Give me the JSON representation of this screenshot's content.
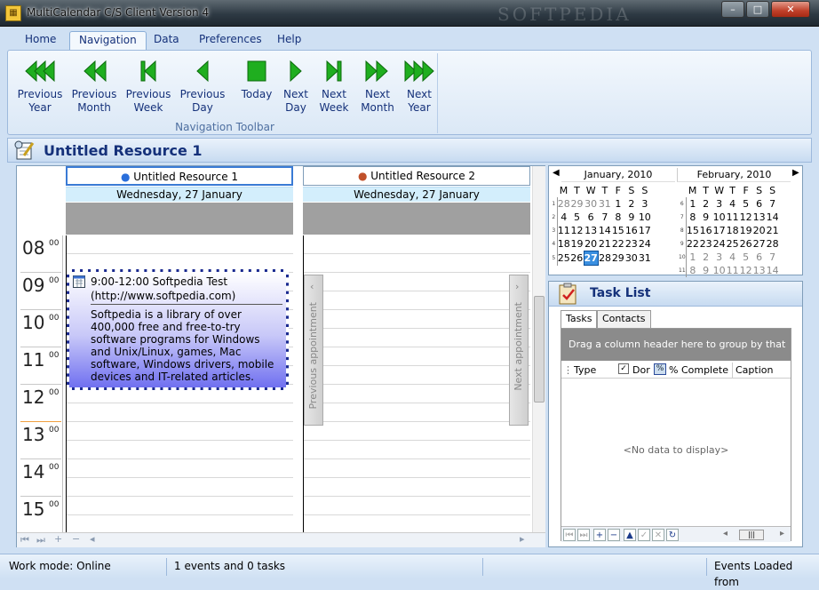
{
  "window": {
    "title": "MultiCalendar C/S Client Version 4",
    "watermark": "SOFTPEDIA",
    "controls": {
      "minimize": "–",
      "maximize": "□",
      "close": "✕"
    }
  },
  "ribbon": {
    "tabs": [
      "Home",
      "Navigation",
      "Data",
      "Preferences",
      "Help"
    ],
    "active_tab": "Navigation",
    "group_label": "Navigation Toolbar",
    "buttons": [
      {
        "line1": "Previous",
        "line2": "Year",
        "icon": "triple-left-arrow-icon"
      },
      {
        "line1": "Previous",
        "line2": "Month",
        "icon": "double-left-arrow-icon"
      },
      {
        "line1": "Previous",
        "line2": "Week",
        "icon": "bar-left-arrow-icon"
      },
      {
        "line1": "Previous",
        "line2": "Day",
        "icon": "left-arrow-icon"
      },
      {
        "line1": "Today",
        "line2": "",
        "icon": "square-stop-icon"
      },
      {
        "line1": "Next",
        "line2": "Day",
        "icon": "right-arrow-icon"
      },
      {
        "line1": "Next",
        "line2": "Week",
        "icon": "bar-right-arrow-icon"
      },
      {
        "line1": "Next",
        "line2": "Month",
        "icon": "double-right-arrow-icon"
      },
      {
        "line1": "Next",
        "line2": "Year",
        "icon": "triple-right-arrow-icon"
      }
    ],
    "icon_color": "#1fae1f"
  },
  "resource_header": {
    "title": "Untitled Resource 1"
  },
  "scheduler": {
    "resources": [
      {
        "name": "Untitled Resource 1",
        "date": "Wednesday, 27 January"
      },
      {
        "name": "Untitled Resource 2",
        "date": "Wednesday, 27 January"
      }
    ],
    "hours": [
      "08",
      "09",
      "10",
      "11",
      "12",
      "13",
      "14",
      "15"
    ],
    "minutes_label": "00",
    "appointment": {
      "title": "9:00-12:00 Softpedia Test",
      "subtitle": "(http://www.softpedia.com)",
      "body": "Softpedia is a library of over 400,000 free and free-to-try software programs for Windows and Unix/Linux, games, Mac software, Windows drivers, mobile devices and IT-related articles."
    },
    "prev_appointment": "Previous appointment",
    "next_appointment": "Next appointment"
  },
  "mini_calendar": {
    "months": [
      {
        "title": "January, 2010",
        "day_headers": [
          "M",
          "T",
          "W",
          "T",
          "F",
          "S",
          "S"
        ],
        "weeks": [
          {
            "wk": "1",
            "days": [
              "28",
              "29",
              "30",
              "31",
              "1",
              "2",
              "3"
            ],
            "dim": [
              0,
              1,
              2,
              3
            ]
          },
          {
            "wk": "2",
            "days": [
              "4",
              "5",
              "6",
              "7",
              "8",
              "9",
              "10"
            ],
            "dim": []
          },
          {
            "wk": "3",
            "days": [
              "11",
              "12",
              "13",
              "14",
              "15",
              "16",
              "17"
            ],
            "dim": []
          },
          {
            "wk": "4",
            "days": [
              "18",
              "19",
              "20",
              "21",
              "22",
              "23",
              "24"
            ],
            "dim": []
          },
          {
            "wk": "5",
            "days": [
              "25",
              "26",
              "27",
              "28",
              "29",
              "30",
              "31"
            ],
            "dim": []
          }
        ],
        "today": "27"
      },
      {
        "title": "February, 2010",
        "day_headers": [
          "M",
          "T",
          "W",
          "T",
          "F",
          "S",
          "S"
        ],
        "weeks": [
          {
            "wk": "6",
            "days": [
              "1",
              "2",
              "3",
              "4",
              "5",
              "6",
              "7"
            ],
            "dim": []
          },
          {
            "wk": "7",
            "days": [
              "8",
              "9",
              "10",
              "11",
              "12",
              "13",
              "14"
            ],
            "dim": []
          },
          {
            "wk": "8",
            "days": [
              "15",
              "16",
              "17",
              "18",
              "19",
              "20",
              "21"
            ],
            "dim": []
          },
          {
            "wk": "9",
            "days": [
              "22",
              "23",
              "24",
              "25",
              "26",
              "27",
              "28"
            ],
            "dim": []
          },
          {
            "wk": "10",
            "days": [
              "1",
              "2",
              "3",
              "4",
              "5",
              "6",
              "7"
            ],
            "dim": [
              0,
              1,
              2,
              3,
              4,
              5,
              6
            ]
          },
          {
            "wk": "11",
            "days": [
              "8",
              "9",
              "10",
              "11",
              "12",
              "13",
              "14"
            ],
            "dim": [
              0,
              1,
              2,
              3,
              4,
              5,
              6
            ]
          }
        ],
        "today": ""
      }
    ]
  },
  "task_list": {
    "title": "Task List",
    "tabs": [
      "Tasks",
      "Contacts"
    ],
    "group_hint": "Drag a column header here to group by that column",
    "columns": [
      "Type",
      "Dor",
      "% Complete",
      "Caption"
    ],
    "empty_text": "<No data to display>"
  },
  "status_bar": {
    "work_mode": "Work mode: Online",
    "events": "1 events and 0 tasks",
    "loaded": "Events Loaded from"
  }
}
